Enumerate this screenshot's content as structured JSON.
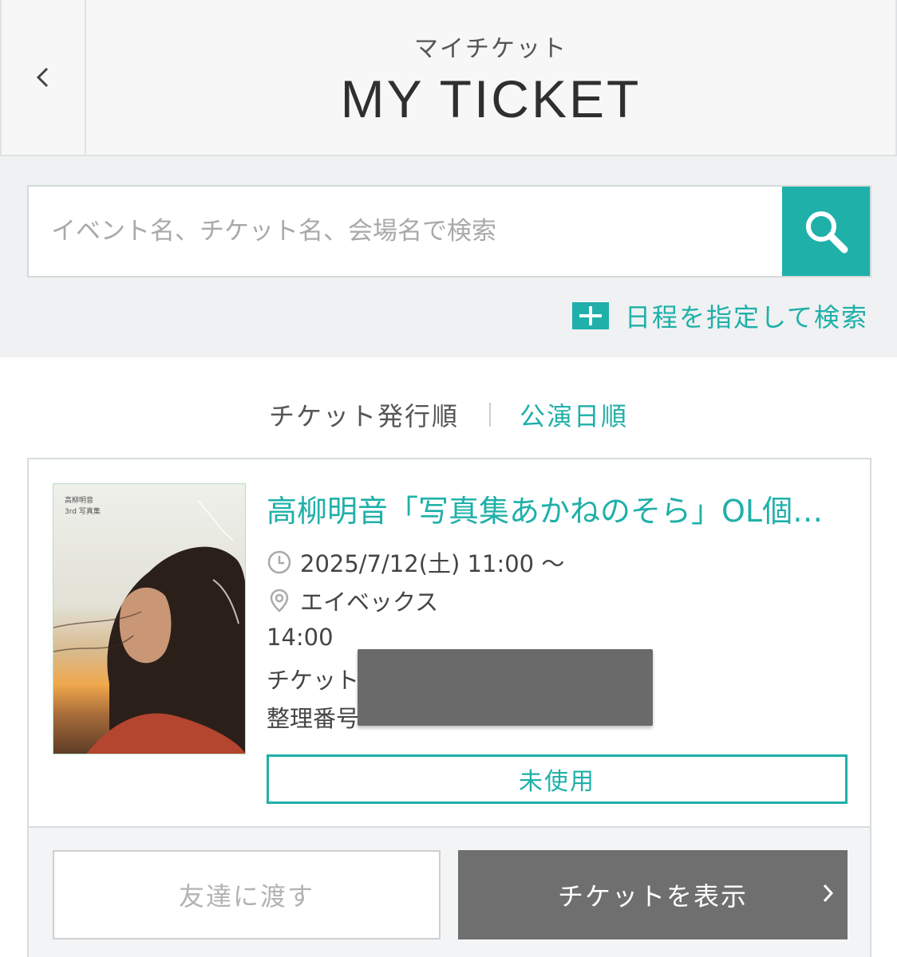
{
  "header": {
    "subtitle": "マイチケット",
    "title": "MY TICKET",
    "back_icon": "chevron-left-icon"
  },
  "search": {
    "placeholder": "イベント名、チケット名、会場名で検索",
    "button_icon": "search-icon",
    "date_search_label": "日程を指定して検索",
    "accent_color": "#1fb0a9"
  },
  "sort": {
    "issue_order_label": "チケット発行順",
    "show_date_label": "公演日順",
    "active": "公演日順"
  },
  "ticket": {
    "cover_caption_line1": "高柳明音",
    "cover_caption_line2": "3rd 写真集",
    "title": "高柳明音「写真集あかねのそら」OL個別お話し会",
    "datetime": "2025/7/12(土) 11:00 〜",
    "venue": "エイベックス",
    "time_slot": "14:00",
    "ticket_label": "チケット",
    "number_label": "整理番号",
    "status": "未使用"
  },
  "actions": {
    "transfer_label": "友達に渡す",
    "show_ticket_label": "チケットを表示"
  }
}
